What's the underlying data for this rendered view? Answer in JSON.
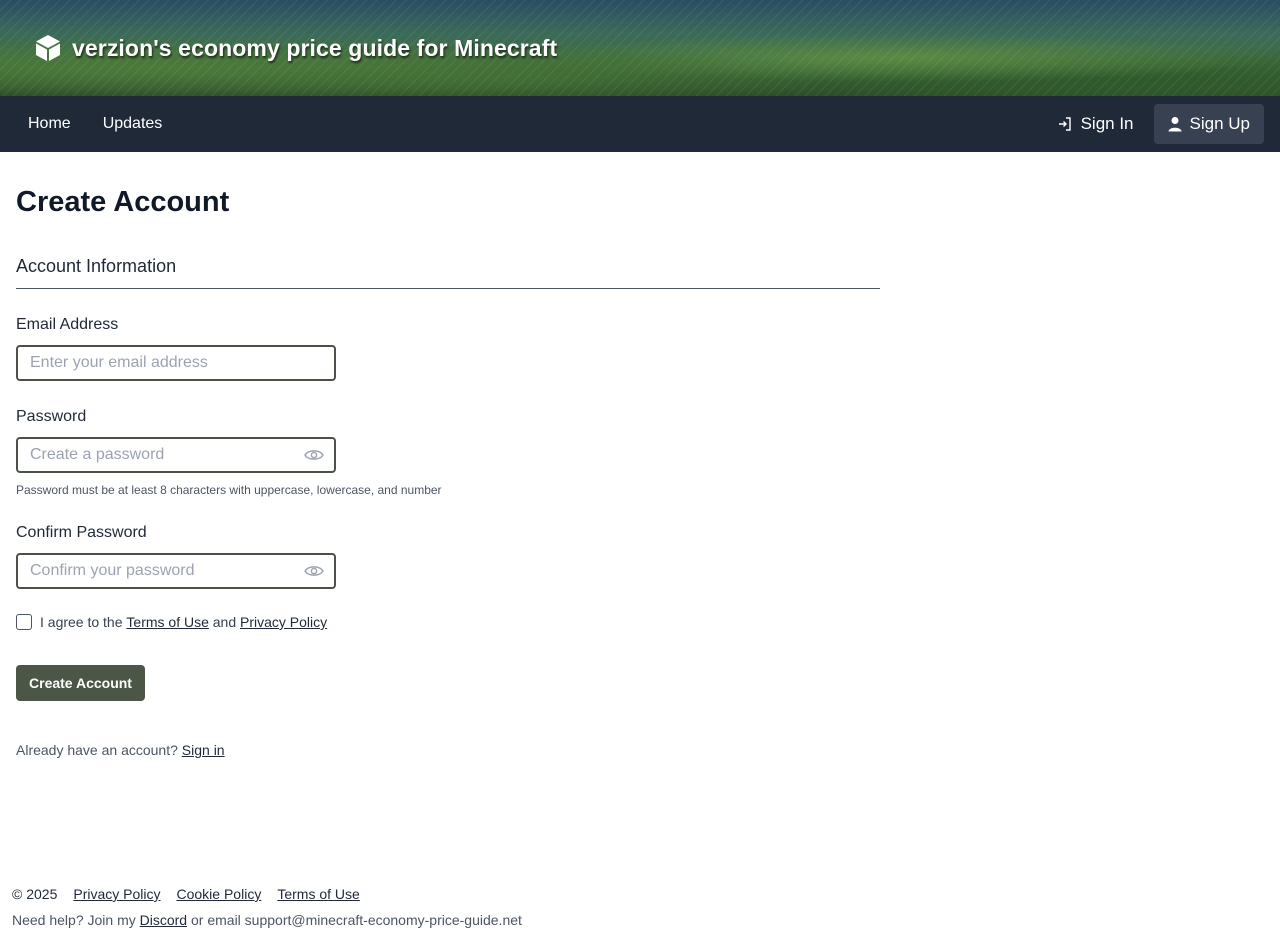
{
  "banner": {
    "title": "verzion's economy price guide for Minecraft",
    "logo_icon": "cube-icon"
  },
  "nav": {
    "home": "Home",
    "updates": "Updates",
    "sign_in": "Sign In",
    "sign_up": "Sign Up"
  },
  "page": {
    "title": "Create Account",
    "section": "Account Information"
  },
  "form": {
    "email_label": "Email Address",
    "email_placeholder": "Enter your email address",
    "password_label": "Password",
    "password_placeholder": "Create a password",
    "password_hint": "Password must be at least 8 characters with uppercase, lowercase, and number",
    "confirm_label": "Confirm Password",
    "confirm_placeholder": "Confirm your password",
    "agree_prefix": "I agree to the",
    "terms_link": "Terms of Use",
    "agree_and": "and",
    "privacy_link": "Privacy Policy",
    "submit": "Create Account",
    "already_text": "Already have an account?",
    "sign_in_link": "Sign in"
  },
  "footer": {
    "copyright": "© 2025",
    "privacy": "Privacy Policy",
    "cookie": "Cookie Policy",
    "terms": "Terms of Use",
    "help_prefix": "Need help? Join my",
    "discord": "Discord",
    "help_suffix": "or email support@minecraft-economy-price-guide.net"
  },
  "colors": {
    "navbar": "#1f2937",
    "signup_bg": "#374151",
    "primary_button": "#4b5647",
    "input_border": "#4b5348"
  }
}
